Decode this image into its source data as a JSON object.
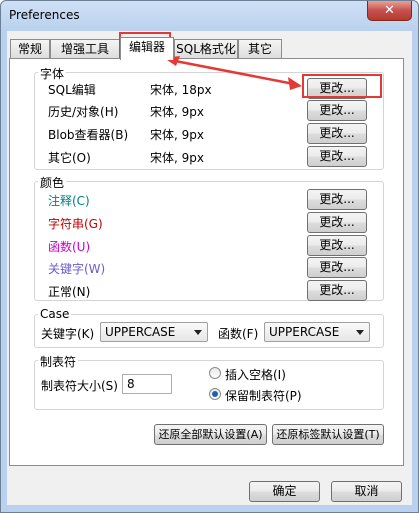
{
  "window": {
    "title": "Preferences",
    "close_glyph": "✕"
  },
  "tabs": [
    {
      "label": "常规"
    },
    {
      "label": "增强工具"
    },
    {
      "label": "编辑器",
      "selected": true
    },
    {
      "label": "SQL格式化"
    },
    {
      "label": "其它"
    }
  ],
  "font_group": {
    "title": "字体",
    "change_label": "更改...",
    "items": [
      {
        "label": "SQL编辑",
        "value": "宋体, 18px",
        "highlighted": true
      },
      {
        "label": "历史/对象(H)",
        "value": "宋体, 9px"
      },
      {
        "label": "Blob查看器(B)",
        "value": "宋体, 9px"
      },
      {
        "label": "其它(O)",
        "value": "宋体, 9px"
      }
    ]
  },
  "color_group": {
    "title": "颜色",
    "change_label": "更改...",
    "items": [
      {
        "label": "注释(C)",
        "color": "#008080"
      },
      {
        "label": "字符串(G)",
        "color": "#c00000"
      },
      {
        "label": "函数(U)",
        "color": "#cc00cc"
      },
      {
        "label": "关键字(W)",
        "color": "#6a5acd"
      },
      {
        "label": "正常(N)",
        "color": "#000000"
      }
    ]
  },
  "case_group": {
    "title": "Case",
    "keyword_label": "关键字(K)",
    "keyword_value": "UPPERCASE",
    "function_label": "函数(F)",
    "function_value": "UPPERCASE"
  },
  "tab_group": {
    "title": "制表符",
    "size_label": "制表符大小(S)",
    "size_value": "8",
    "insert_spaces_label": "插入空格(I)",
    "keep_tabs_label": "保留制表符(P)",
    "selected": "keep_tabs"
  },
  "buttons": {
    "restore_all": "还原全部默认设置(A)",
    "restore_tab": "还原标签默认设置(T)",
    "ok": "确定",
    "cancel": "取消"
  },
  "annotation": {
    "color": "#e53935"
  }
}
